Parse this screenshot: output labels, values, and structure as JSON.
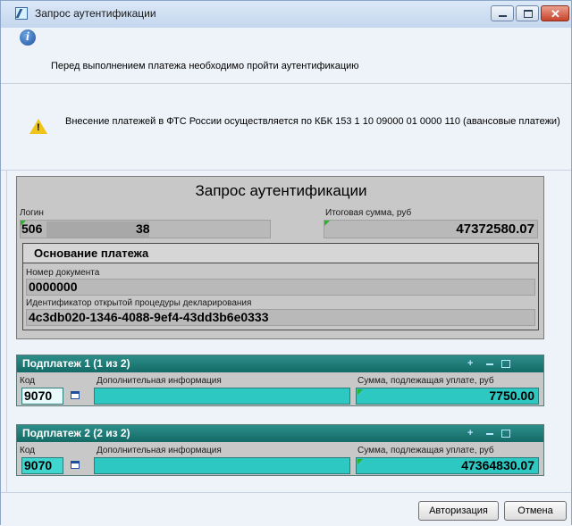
{
  "window": {
    "title": "Запрос аутентификации",
    "icon": "app-icon"
  },
  "messages": {
    "info": "Перед выполнением платежа необходимо пройти аутентификацию",
    "warning": "Внесение платежей в ФТС России осуществляется по КБК 153 1 10 09000 01 0000 110 (авансовые платежи)"
  },
  "form": {
    "title": "Запрос аутентификации",
    "login_label": "Логин",
    "login_prefix": "506",
    "login_suffix": "38",
    "total_label": "Итоговая сумма, руб",
    "total_value": "47372580.07",
    "basis": {
      "title": "Основание платежа",
      "doc_label": "Номер документа",
      "doc_value": "0000000",
      "id_label": "Идентификатор открытой процедуры декларирования",
      "id_value": "4c3db020-1346-4088-9ef4-43dd3b6e0333"
    }
  },
  "subpayments": [
    {
      "title": "Подплатеж 1 (1 из 2)",
      "code_label": "Код",
      "code_value": "9070",
      "info_label": "Дополнительная информация",
      "sum_label": "Сумма, подлежащая уплате, руб",
      "sum_value": "7750.00"
    },
    {
      "title": "Подплатеж 2 (2 из 2)",
      "code_label": "Код",
      "code_value": "9070",
      "info_label": "Дополнительная информация",
      "sum_label": "Сумма, подлежащая уплате, руб",
      "sum_value": "47364830.07"
    }
  ],
  "buttons": {
    "auth": "Авторизация",
    "cancel": "Отмена"
  },
  "colors": {
    "accent_teal": "#136a66",
    "field_teal": "#2ec8c2",
    "window_bg": "#eef3fa",
    "form_gray": "#c8c8c8"
  }
}
